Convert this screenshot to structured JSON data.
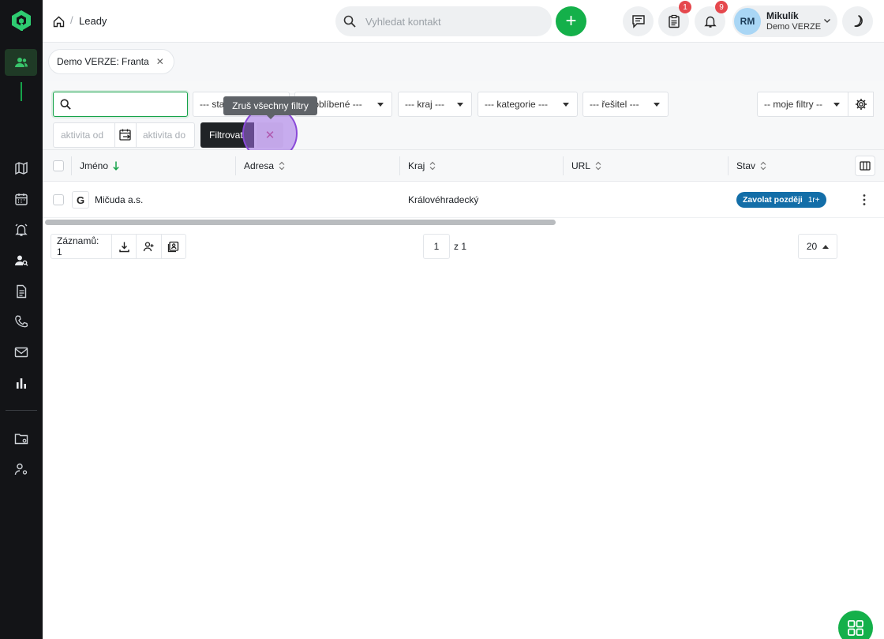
{
  "breadcrumb": {
    "current": "Leady"
  },
  "search": {
    "placeholder": "Vyhledat kontakt"
  },
  "badges": {
    "tasks": "1",
    "notifications": "9"
  },
  "user": {
    "initials": "RM",
    "name": "Mikulík",
    "org": "Demo VERZE"
  },
  "tab_chip": {
    "label": "Demo VERZE: Franta"
  },
  "filters": {
    "stav": "--- stav ---",
    "oblibene": "--- oblíbené ---",
    "kraj": "--- kraj ---",
    "kategorie": "--- kategorie ---",
    "resitel": "--- řešitel ---",
    "moje_filtry": "-- moje filtry --",
    "activity_from_placeholder": "aktivita od",
    "activity_to_placeholder": "aktivita do",
    "filter_button": "Filtrovat",
    "clear_tooltip": "Zruš všechny filtry"
  },
  "table": {
    "columns": [
      "Jméno",
      "Adresa",
      "Kraj",
      "URL",
      "Stav"
    ],
    "rows": [
      {
        "name": "Mičuda a.s.",
        "address": "",
        "kraj": "Královéhradecký",
        "url": "",
        "status": "Zavolat později",
        "status_sub": "1r+"
      }
    ]
  },
  "footer": {
    "records": "Záznamů: 1",
    "page": "1",
    "of": "z 1",
    "per_page": "20"
  },
  "colors": {
    "accent": "#14b04a",
    "status": "#136ea8",
    "sidebar": "#131417"
  }
}
